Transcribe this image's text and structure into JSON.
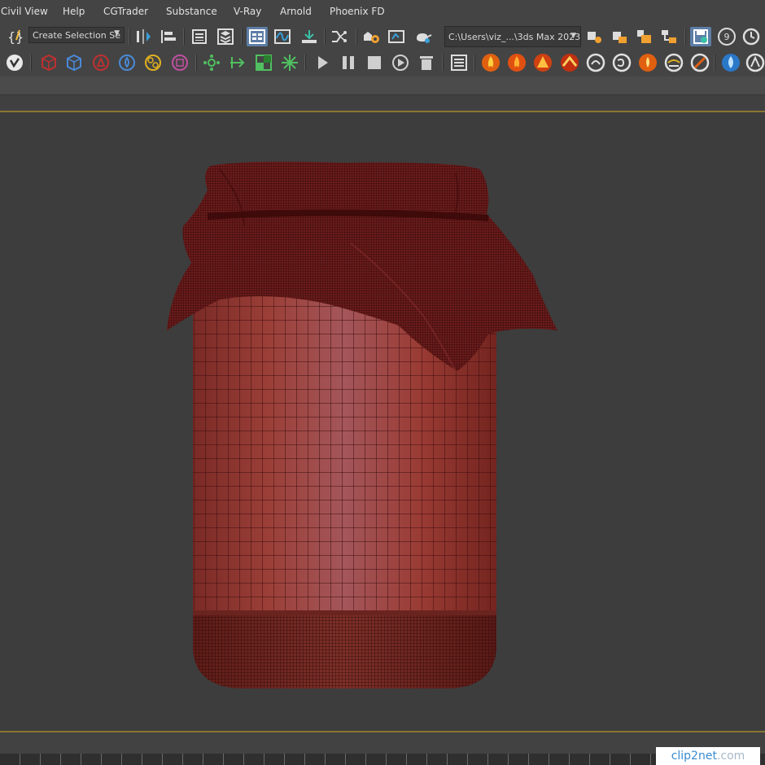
{
  "menu": {
    "items": [
      "Civil View",
      "Help",
      "CGTrader",
      "Substance",
      "V-Ray",
      "Arnold",
      "Phoenix FD"
    ]
  },
  "toolbar1": {
    "selection_set_value": "Create Selection Se",
    "project_path_value": "C:\\Users\\viz_...\\3ds Max 2023",
    "badge_number": "9"
  },
  "toolbar2": {
    "icons": [
      "vray-logo-icon",
      "vray-geometry-icon",
      "vray-proxy-icon",
      "vray-light-icon",
      "vray-dome-icon",
      "vray-sphere-icon",
      "vray-box-icon",
      "vray-network-icon",
      "vray-arrow-icon",
      "vray-grid-icon",
      "vray-sun-icon",
      "play-icon",
      "pause-icon",
      "stop-icon",
      "render-icon",
      "trash-icon",
      "list-icon",
      "fire-icon",
      "fire-shield-icon",
      "fire-burst-icon",
      "fire-splash-icon",
      "smoke-icon",
      "smoke-swirl-icon",
      "flame-icon",
      "foam-icon",
      "paint-icon",
      "water-drop-icon",
      "liquid-icon"
    ]
  },
  "watermark": {
    "text_a": "clip2net",
    "text_b": ".com"
  },
  "colors": {
    "ui_bg": "#444444",
    "viewport_bg": "#3d3d3d",
    "viewport_border": "#8a7632",
    "jar_red": "#9b3b34",
    "cloth_red": "#6a1c1c",
    "wire": "#2a0a0a"
  }
}
